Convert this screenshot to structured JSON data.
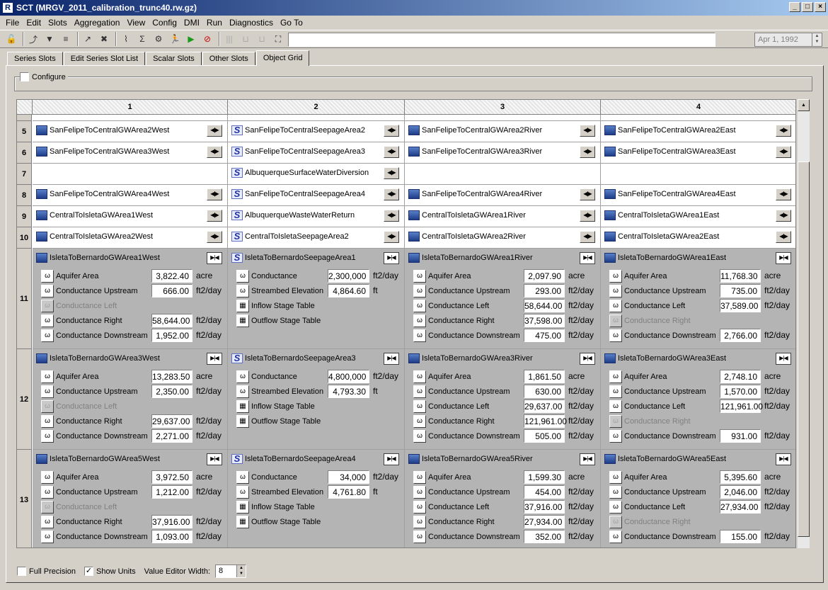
{
  "window": {
    "title": "SCT  (MRGV_2011_calibration_trunc40.rw.gz)"
  },
  "menu": [
    "File",
    "Edit",
    "Slots",
    "Aggregation",
    "View",
    "Config",
    "DMI",
    "Run",
    "Diagnostics",
    "Go To"
  ],
  "toolbar": {
    "date": "Apr 1, 1992",
    "input_value": ""
  },
  "tabs": [
    "Series Slots",
    "Edit Series Slot List",
    "Scalar Slots",
    "Other Slots",
    "Object Grid"
  ],
  "active_tab": "Object Grid",
  "configure_label": "Configure",
  "columns": [
    "1",
    "2",
    "3",
    "4"
  ],
  "rows": [
    {
      "n": "5",
      "cells": [
        {
          "name": "SanFelipeToCentralGWArea2West",
          "t": "gw"
        },
        {
          "name": "SanFelipeToCentralSeepageArea2",
          "t": "s"
        },
        {
          "name": "SanFelipeToCentralGWArea2River",
          "t": "gw"
        },
        {
          "name": "SanFelipeToCentralGWArea2East",
          "t": "gw"
        }
      ]
    },
    {
      "n": "6",
      "cells": [
        {
          "name": "SanFelipeToCentralGWArea3West",
          "t": "gw"
        },
        {
          "name": "SanFelipeToCentralSeepageArea3",
          "t": "s"
        },
        {
          "name": "SanFelipeToCentralGWArea3River",
          "t": "gw"
        },
        {
          "name": "SanFelipeToCentralGWArea3East",
          "t": "gw"
        }
      ]
    },
    {
      "n": "7",
      "cells": [
        null,
        {
          "name": "AlbuquerqueSurfaceWaterDiversion",
          "t": "s"
        },
        null,
        null
      ]
    },
    {
      "n": "8",
      "cells": [
        {
          "name": "SanFelipeToCentralGWArea4West",
          "t": "gw"
        },
        {
          "name": "SanFelipeToCentralSeepageArea4",
          "t": "s"
        },
        {
          "name": "SanFelipeToCentralGWArea4River",
          "t": "gw"
        },
        {
          "name": "SanFelipeToCentralGWArea4East",
          "t": "gw"
        }
      ]
    },
    {
      "n": "9",
      "cells": [
        {
          "name": "CentralToIsletaGWArea1West",
          "t": "gw"
        },
        {
          "name": "AlbuquerqueWasteWaterReturn",
          "t": "s"
        },
        {
          "name": "CentralToIsletaGWArea1River",
          "t": "gw"
        },
        {
          "name": "CentralToIsletaGWArea1East",
          "t": "gw"
        }
      ]
    },
    {
      "n": "10",
      "cells": [
        {
          "name": "CentralToIsletaGWArea2West",
          "t": "gw"
        },
        {
          "name": "CentralToIsletaSeepageArea2",
          "t": "s"
        },
        {
          "name": "CentralToIsletaGWArea2River",
          "t": "gw"
        },
        {
          "name": "CentralToIsletaGWArea2East",
          "t": "gw"
        }
      ]
    }
  ],
  "expanded_rows": [
    {
      "n": "11",
      "cells": [
        {
          "name": "IsletaToBernardoGWArea1West",
          "t": "gw",
          "slots": [
            {
              "label": "Aquifer Area",
              "value": "3,822.40",
              "unit": "acre"
            },
            {
              "label": "Conductance Upstream",
              "value": "666.00",
              "unit": "ft2/day"
            },
            {
              "label": "Conductance Left",
              "disabled": true
            },
            {
              "label": "Conductance Right",
              "value": "58,644.00",
              "unit": "ft2/day"
            },
            {
              "label": "Conductance Downstream",
              "value": "1,952.00",
              "unit": "ft2/day"
            }
          ]
        },
        {
          "name": "IsletaToBernardoSeepageArea1",
          "t": "s",
          "slots": [
            {
              "label": "Conductance",
              "value": "2,300,000",
              "unit": "ft2/day"
            },
            {
              "label": "Streambed Elevation",
              "value": "4,864.60",
              "unit": "ft"
            },
            {
              "label": "Inflow Stage Table",
              "table": true
            },
            {
              "label": "Outflow Stage Table",
              "table": true
            }
          ]
        },
        {
          "name": "IsletaToBernardoGWArea1River",
          "t": "gw",
          "slots": [
            {
              "label": "Aquifer Area",
              "value": "2,097.90",
              "unit": "acre"
            },
            {
              "label": "Conductance Upstream",
              "value": "293.00",
              "unit": "ft2/day"
            },
            {
              "label": "Conductance Left",
              "value": "58,644.00",
              "unit": "ft2/day"
            },
            {
              "label": "Conductance Right",
              "value": "37,598.00",
              "unit": "ft2/day"
            },
            {
              "label": "Conductance Downstream",
              "value": "475.00",
              "unit": "ft2/day"
            }
          ]
        },
        {
          "name": "IsletaToBernardoGWArea1East",
          "t": "gw",
          "slots": [
            {
              "label": "Aquifer Area",
              "value": "11,768.30",
              "unit": "acre"
            },
            {
              "label": "Conductance Upstream",
              "value": "735.00",
              "unit": "ft2/day"
            },
            {
              "label": "Conductance Left",
              "value": "37,589.00",
              "unit": "ft2/day"
            },
            {
              "label": "Conductance Right",
              "disabled": true
            },
            {
              "label": "Conductance Downstream",
              "value": "2,766.00",
              "unit": "ft2/day"
            }
          ]
        }
      ]
    },
    {
      "n": "12",
      "cells": [
        {
          "name": "IsletaToBernardoGWArea3West",
          "t": "gw",
          "slots": [
            {
              "label": "Aquifer Area",
              "value": "13,283.50",
              "unit": "acre"
            },
            {
              "label": "Conductance Upstream",
              "value": "2,350.00",
              "unit": "ft2/day"
            },
            {
              "label": "Conductance Left",
              "disabled": true
            },
            {
              "label": "Conductance Right",
              "value": "29,637.00",
              "unit": "ft2/day"
            },
            {
              "label": "Conductance Downstream",
              "value": "2,271.00",
              "unit": "ft2/day"
            }
          ]
        },
        {
          "name": "IsletaToBernardoSeepageArea3",
          "t": "s",
          "slots": [
            {
              "label": "Conductance",
              "value": "4,800,000",
              "unit": "ft2/day"
            },
            {
              "label": "Streambed Elevation",
              "value": "4,793.30",
              "unit": "ft"
            },
            {
              "label": "Inflow Stage Table",
              "table": true
            },
            {
              "label": "Outflow Stage Table",
              "table": true
            }
          ]
        },
        {
          "name": "IsletaToBernardoGWArea3River",
          "t": "gw",
          "slots": [
            {
              "label": "Aquifer Area",
              "value": "1,861.50",
              "unit": "acre"
            },
            {
              "label": "Conductance Upstream",
              "value": "630.00",
              "unit": "ft2/day"
            },
            {
              "label": "Conductance Left",
              "value": "29,637.00",
              "unit": "ft2/day"
            },
            {
              "label": "Conductance Right",
              "value": "121,961.00",
              "unit": "ft2/day"
            },
            {
              "label": "Conductance Downstream",
              "value": "505.00",
              "unit": "ft2/day"
            }
          ]
        },
        {
          "name": "IsletaToBernardoGWArea3East",
          "t": "gw",
          "slots": [
            {
              "label": "Aquifer Area",
              "value": "2,748.10",
              "unit": "acre"
            },
            {
              "label": "Conductance Upstream",
              "value": "1,570.00",
              "unit": "ft2/day"
            },
            {
              "label": "Conductance Left",
              "value": "121,961.00",
              "unit": "ft2/day"
            },
            {
              "label": "Conductance Right",
              "disabled": true
            },
            {
              "label": "Conductance Downstream",
              "value": "931.00",
              "unit": "ft2/day"
            }
          ]
        }
      ]
    },
    {
      "n": "13",
      "cells": [
        {
          "name": "IsletaToBernardoGWArea5West",
          "t": "gw",
          "slots": [
            {
              "label": "Aquifer Area",
              "value": "3,972.50",
              "unit": "acre"
            },
            {
              "label": "Conductance Upstream",
              "value": "1,212.00",
              "unit": "ft2/day"
            },
            {
              "label": "Conductance Left",
              "disabled": true
            },
            {
              "label": "Conductance Right",
              "value": "37,916.00",
              "unit": "ft2/day"
            },
            {
              "label": "Conductance Downstream",
              "value": "1,093.00",
              "unit": "ft2/day"
            }
          ]
        },
        {
          "name": "IsletaToBernardoSeepageArea4",
          "t": "s",
          "slots": [
            {
              "label": "Conductance",
              "value": "34,000",
              "unit": "ft2/day"
            },
            {
              "label": "Streambed Elevation",
              "value": "4,761.80",
              "unit": "ft"
            },
            {
              "label": "Inflow Stage Table",
              "table": true
            },
            {
              "label": "Outflow Stage Table",
              "table": true
            }
          ]
        },
        {
          "name": "IsletaToBernardoGWArea5River",
          "t": "gw",
          "slots": [
            {
              "label": "Aquifer Area",
              "value": "1,599.30",
              "unit": "acre"
            },
            {
              "label": "Conductance Upstream",
              "value": "454.00",
              "unit": "ft2/day"
            },
            {
              "label": "Conductance Left",
              "value": "37,916.00",
              "unit": "ft2/day"
            },
            {
              "label": "Conductance Right",
              "value": "27,934.00",
              "unit": "ft2/day"
            },
            {
              "label": "Conductance Downstream",
              "value": "352.00",
              "unit": "ft2/day"
            }
          ]
        },
        {
          "name": "IsletaToBernardoGWArea5East",
          "t": "gw",
          "slots": [
            {
              "label": "Aquifer Area",
              "value": "5,395.60",
              "unit": "acre"
            },
            {
              "label": "Conductance Upstream",
              "value": "2,046.00",
              "unit": "ft2/day"
            },
            {
              "label": "Conductance Left",
              "value": "27,934.00",
              "unit": "ft2/day"
            },
            {
              "label": "Conductance Right",
              "disabled": true
            },
            {
              "label": "Conductance Downstream",
              "value": "155.00",
              "unit": "ft2/day"
            }
          ]
        }
      ]
    }
  ],
  "bottom": {
    "full_precision": "Full Precision",
    "show_units": "Show Units",
    "value_editor_width_label": "Value Editor Width:",
    "value_editor_width": "8"
  }
}
